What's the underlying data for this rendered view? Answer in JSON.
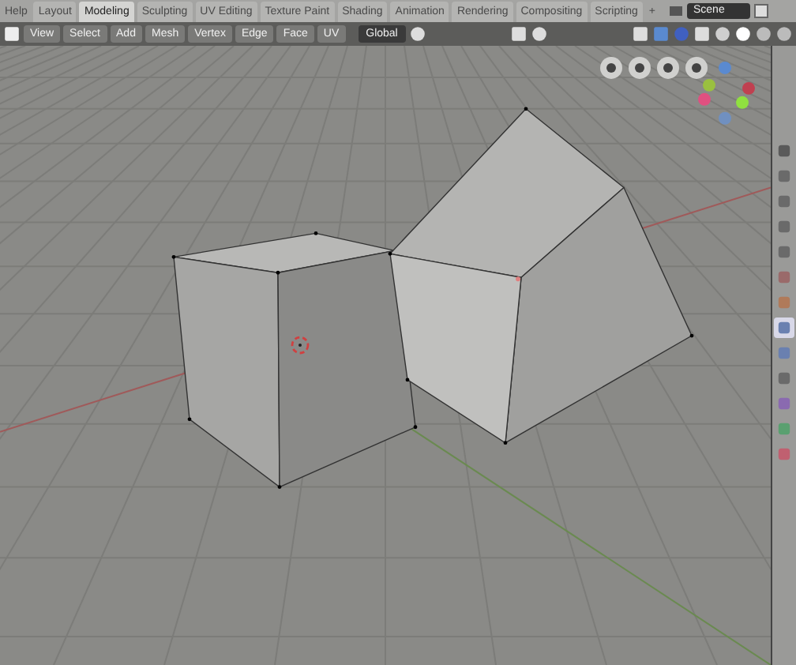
{
  "top_bar": {
    "menu": "Help",
    "workspace_tabs": [
      {
        "label": "Layout",
        "selected": false
      },
      {
        "label": "Modeling",
        "selected": true
      },
      {
        "label": "Sculpting",
        "selected": false
      },
      {
        "label": "UV Editing",
        "selected": false
      },
      {
        "label": "Texture Paint",
        "selected": false
      },
      {
        "label": "Shading",
        "selected": false
      },
      {
        "label": "Animation",
        "selected": false
      },
      {
        "label": "Rendering",
        "selected": false
      },
      {
        "label": "Compositing",
        "selected": false
      },
      {
        "label": "Scripting",
        "selected": false
      }
    ],
    "add_tab": "+",
    "scene_field": {
      "value": "Scene"
    }
  },
  "header": {
    "menus": [
      "View",
      "Select",
      "Add",
      "Mesh",
      "Vertex",
      "Edge",
      "Face",
      "UV"
    ],
    "transform_orientation": "Global"
  },
  "properties_tabs": [
    {
      "color": "#5a5a5a",
      "selected": false
    },
    {
      "color": "#6a6a6a",
      "selected": false
    },
    {
      "color": "#6a6a6a",
      "selected": false
    },
    {
      "color": "#6a6a6a",
      "selected": false
    },
    {
      "color": "#6a6a6a",
      "selected": false
    },
    {
      "color": "#9a6a6a",
      "selected": false
    },
    {
      "color": "#b07a5a",
      "selected": false
    },
    {
      "color": "#6a80b0",
      "selected": true
    },
    {
      "color": "#6a80b0",
      "selected": false
    },
    {
      "color": "#6a6a6a",
      "selected": false
    },
    {
      "color": "#8a6ab0",
      "selected": false
    },
    {
      "color": "#5aa070",
      "selected": false
    },
    {
      "color": "#c06070",
      "selected": false
    }
  ]
}
